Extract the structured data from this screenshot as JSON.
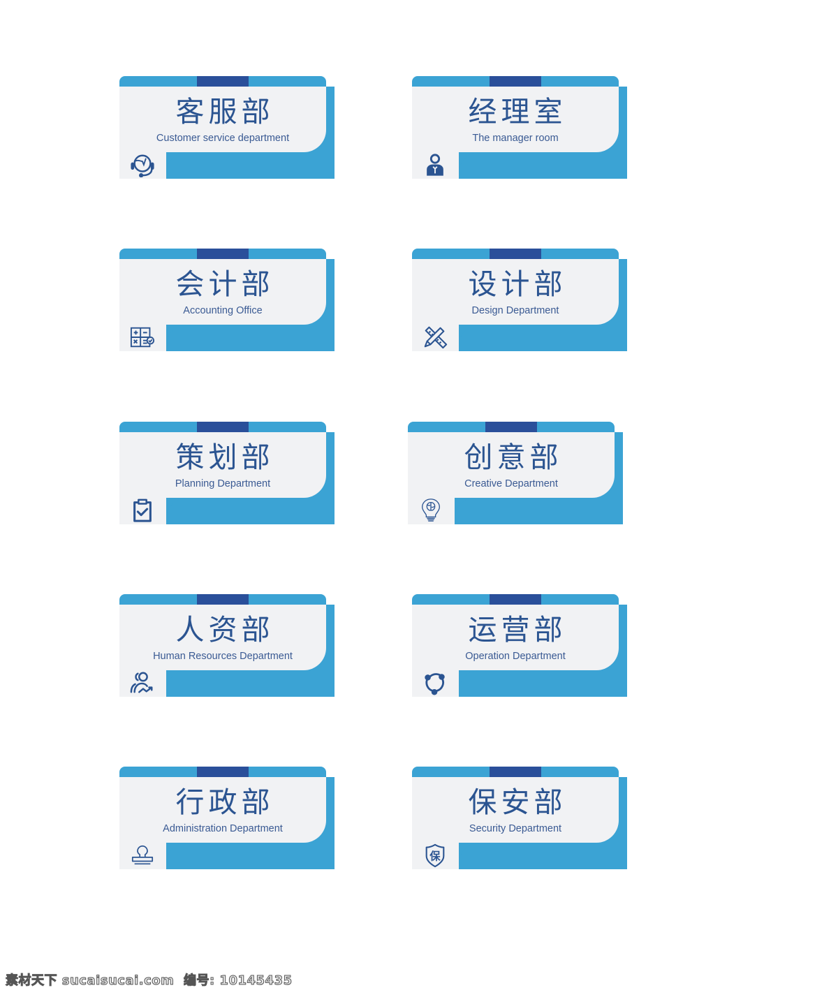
{
  "colors": {
    "accent_light": "#3ba3d4",
    "accent_dark": "#2a4f9a",
    "panel": "#f1f2f4",
    "text": "#2b5491"
  },
  "signs": [
    {
      "title": "客服部",
      "subtitle": "Customer service department",
      "icon": "headset-icon"
    },
    {
      "title": "经理室",
      "subtitle": "The manager room",
      "icon": "manager-icon"
    },
    {
      "title": "会计部",
      "subtitle": "Accounting Office",
      "icon": "calculator-icon"
    },
    {
      "title": "设计部",
      "subtitle": "Design Department",
      "icon": "ruler-pencil-icon"
    },
    {
      "title": "策划部",
      "subtitle": "Planning Department",
      "icon": "clipboard-check-icon"
    },
    {
      "title": "创意部",
      "subtitle": "Creative Department",
      "icon": "lightbulb-brain-icon"
    },
    {
      "title": "人资部",
      "subtitle": "Human Resources Department",
      "icon": "people-growth-icon"
    },
    {
      "title": "运营部",
      "subtitle": "Operation Department",
      "icon": "cycle-nodes-icon"
    },
    {
      "title": "行政部",
      "subtitle": "Administration Department",
      "icon": "stamp-icon"
    },
    {
      "title": "保安部",
      "subtitle": "Security Department",
      "icon": "security-shield-icon"
    }
  ],
  "watermark": {
    "text": "素材天下 sucaisucai.com  编号: 10145435"
  }
}
